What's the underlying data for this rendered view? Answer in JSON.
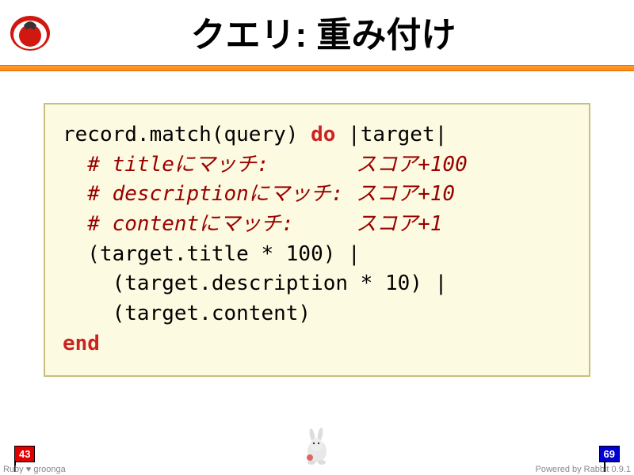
{
  "header": {
    "title": "クエリ: 重み付け"
  },
  "code": {
    "l1a": "record.match(query) ",
    "l1b": "do",
    "l1c": " |target|",
    "l2": "  # titleにマッチ:       スコア+100",
    "l3": "  # descriptionにマッチ: スコア+10",
    "l4": "  # contentにマッチ:     スコア+1",
    "l5": "  (target.title * 100) |",
    "l6": "    (target.description * 10) |",
    "l7": "    (target.content)",
    "l8": "end"
  },
  "footer": {
    "current_page": "43",
    "total_pages": "69",
    "left_text_a": "Ruby ",
    "left_text_heart": "♥",
    "left_text_b": " groonga",
    "right_text": "Powered by Rabbit 0.9.1"
  }
}
